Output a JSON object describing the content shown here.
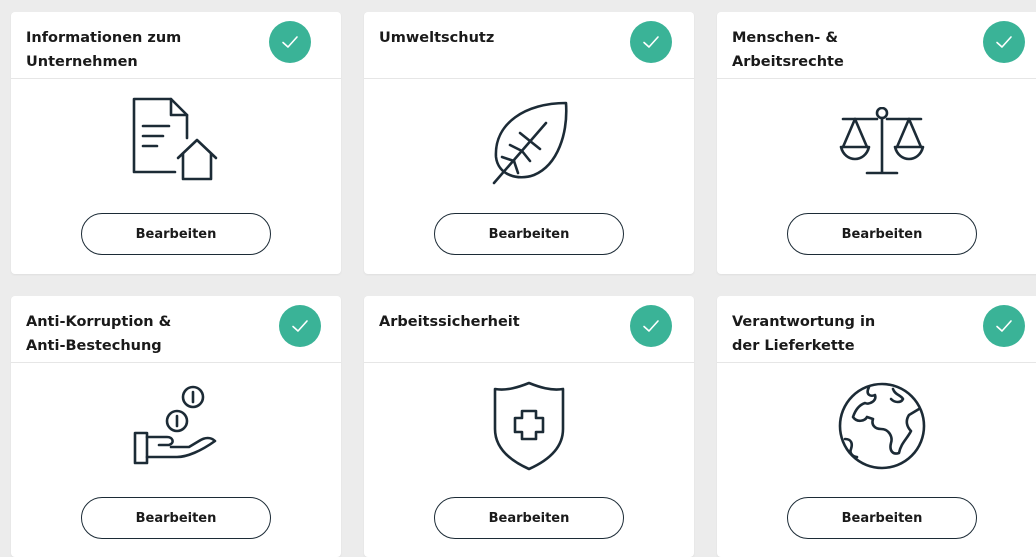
{
  "cards": [
    {
      "title": "Informationen zum\nUnternehmen",
      "button": "Bearbeiten",
      "icon": "document-house-icon",
      "status": "complete"
    },
    {
      "title": "Umweltschutz",
      "button": "Bearbeiten",
      "icon": "leaf-icon",
      "status": "complete"
    },
    {
      "title": "Menschen- &\nArbeitsrechte",
      "button": "Bearbeiten",
      "icon": "scales-icon",
      "status": "complete"
    },
    {
      "title": "Anti-Korruption &\nAnti-Bestechung",
      "button": "Bearbeiten",
      "icon": "hand-coins-icon",
      "status": "complete"
    },
    {
      "title": "Arbeitssicherheit",
      "button": "Bearbeiten",
      "icon": "shield-cross-icon",
      "status": "complete"
    },
    {
      "title": "Verantwortung in\nder Lieferkette",
      "button": "Bearbeiten",
      "icon": "globe-icon",
      "status": "complete"
    }
  ],
  "colors": {
    "check": "#3ab397",
    "icon_stroke": "#1c2b36",
    "background": "#ececec"
  }
}
